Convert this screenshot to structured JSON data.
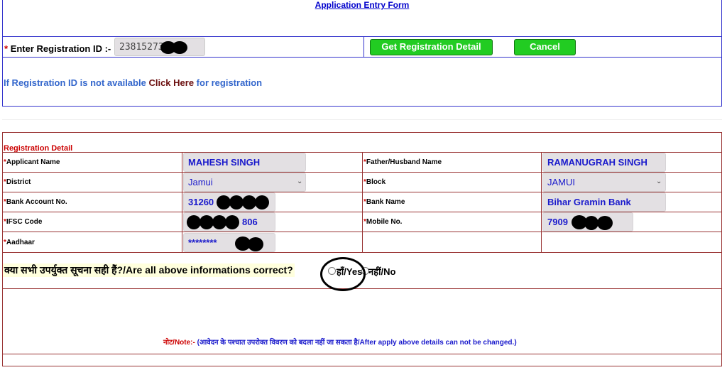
{
  "header": {
    "title": "Application Entry Form"
  },
  "registration": {
    "required_mark": "*",
    "label": "Enter Registration ID :-",
    "id_value": "23815273",
    "get_button": "Get Registration Detail",
    "cancel_button": "Cancel",
    "hint_prefix": "If Registration ID is not available",
    "hint_link": "Click Here",
    "hint_suffix": "for registration"
  },
  "detail": {
    "section_title": "Registration Detail",
    "fields": {
      "applicant_name": {
        "label": "Applicant Name",
        "value": "MAHESH SINGH"
      },
      "father_name": {
        "label": "Father/Husband Name",
        "value": "RAMANUGRAH SINGH"
      },
      "district": {
        "label": "District",
        "value": "Jamui"
      },
      "block": {
        "label": "Block",
        "value": "JAMUI"
      },
      "bank_account": {
        "label": "Bank Account No.",
        "value": "31260"
      },
      "bank_name": {
        "label": "Bank Name",
        "value": "Bihar Gramin Bank"
      },
      "ifsc": {
        "label": "IFSC Code",
        "value": "806"
      },
      "mobile": {
        "label": "Mobile No.",
        "value": "7909"
      },
      "aadhaar": {
        "label": "Aadhaar",
        "value": "********"
      }
    },
    "confirm": {
      "question": "क्या सभी उपर्युक्त सूचना सही हैं?/Are all above informations correct?",
      "yes_label": "हाँ/Yes",
      "no_label": "नहीं/No"
    },
    "note": {
      "label": "नोट/Note:-",
      "text": "(आवेदन के पश्चात उपरोक्त विवरण को बदला नहीं जा सकता है/After apply above details can not be changed.)"
    }
  },
  "colors": {
    "button": "#22cc22",
    "link_blue": "#3366cc",
    "value_blue": "#1a1acc",
    "required_red": "#cc0000",
    "border_blue": "#3333cc",
    "border_maroon": "#993333"
  }
}
